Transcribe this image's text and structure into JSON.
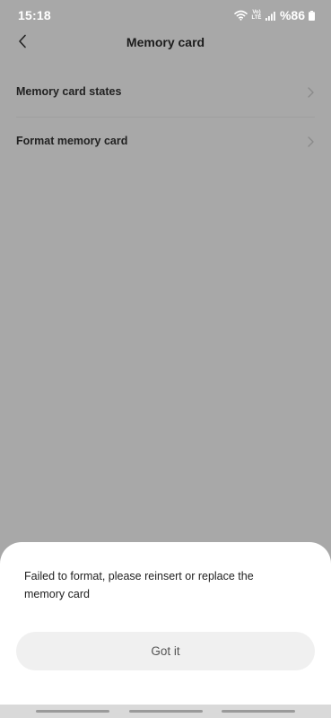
{
  "status_bar": {
    "time": "15:18",
    "network_label": "Vo) LTE",
    "battery_text": "%86",
    "icons": [
      "wifi-icon",
      "volte-icon",
      "signal-icon",
      "battery-icon"
    ]
  },
  "header": {
    "title": "Memory card",
    "back_icon": "chevron-left-icon"
  },
  "menu": {
    "items": [
      {
        "label": "Memory card states",
        "icon": "chevron-right-icon"
      },
      {
        "label": "Format memory card",
        "icon": "chevron-right-icon"
      }
    ]
  },
  "dialog": {
    "message": "Failed to format, please reinsert or replace the memory card",
    "button_label": "Got it"
  },
  "colors": {
    "overlay_background": "#a8a8a8",
    "sheet_background": "#ffffff",
    "button_background": "#f0f0f0",
    "title_text": "#1c1c1c"
  }
}
